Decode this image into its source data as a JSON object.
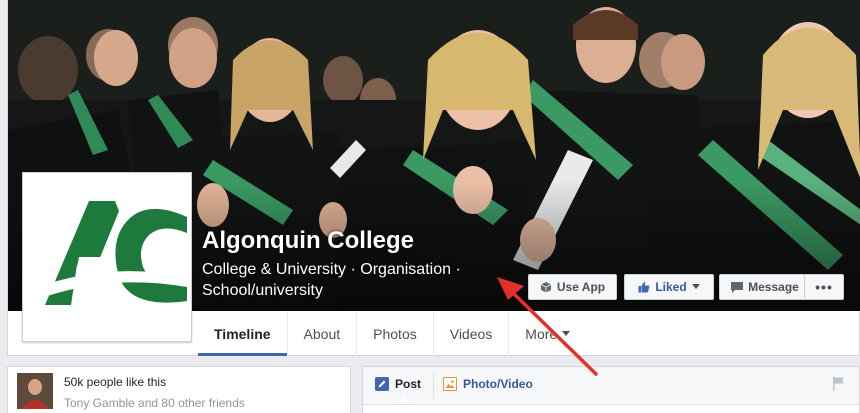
{
  "page": {
    "name": "Algonquin College",
    "category_line1": "College & University · Organisation ·",
    "category_line2": "School/university",
    "logo_text": "AC"
  },
  "actions": {
    "use_app": "Use App",
    "liked": "Liked",
    "message": "Message",
    "more": "•••"
  },
  "tabs": [
    {
      "label": "Timeline",
      "active": true
    },
    {
      "label": "About"
    },
    {
      "label": "Photos"
    },
    {
      "label": "Videos"
    },
    {
      "label": "More"
    }
  ],
  "likes": {
    "count_text": "50k people like this",
    "friends_text": "Tony Gamble and 80 other friends"
  },
  "composer": {
    "post_label": "Post",
    "photo_label": "Photo/Video"
  },
  "colors": {
    "brand_green": "#1e7a3c",
    "facebook_blue": "#4267b2",
    "arrow_red": "#e0312b"
  },
  "icons": {
    "use_app": "cube-icon",
    "liked": "thumbs-up-icon",
    "message": "chat-icon",
    "more_tab": "chevron-down-icon",
    "post": "pencil-icon",
    "photo": "photo-icon",
    "flag": "flag-icon"
  }
}
